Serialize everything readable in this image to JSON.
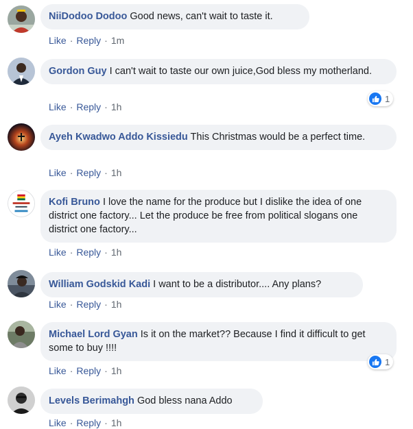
{
  "ui": {
    "like_label": "Like",
    "reply_label": "Reply",
    "separator": "·",
    "accent_link_color": "#385898",
    "bubble_color": "#f0f2f5"
  },
  "comments": [
    {
      "author": "NiiDodoo Dodoo",
      "text": "Good news, can't wait to taste it.",
      "time": "1m",
      "avatar": "man-portrait"
    },
    {
      "author": "Gordon Guy",
      "text": "I can't wait to taste our own juice,God bless my motherland.",
      "time": "1h",
      "avatar": "man-suit",
      "reactions": {
        "icon": "thumbs-up-icon",
        "count": "1"
      }
    },
    {
      "author": "Ayeh Kwadwo Addo Kissiedu",
      "text": "This Christmas would be a perfect time.",
      "time": "1h",
      "avatar": "cross-sunset"
    },
    {
      "author": "Kofi Bruno",
      "text": "I love the name for the produce but I dislike the idea of one district one factory... Let the produce be free from political slogans one district one factory...",
      "time": "1h",
      "avatar": "ghana-flag-logo"
    },
    {
      "author": "William Godskid Kadi",
      "text": "I want to be a distributor.... Any plans?",
      "time": "1h",
      "avatar": "man-cap"
    },
    {
      "author": "Michael Lord Gyan",
      "text": "Is it on the market?? Because I find it difficult to get some to buy !!!!",
      "time": "1h",
      "avatar": "man-outdoor",
      "reactions": {
        "icon": "thumbs-up-icon",
        "count": "1"
      }
    },
    {
      "author": "Levels Berimahgh",
      "text": "God bless nana Addo",
      "time": "1h",
      "avatar": "man-bw"
    }
  ]
}
